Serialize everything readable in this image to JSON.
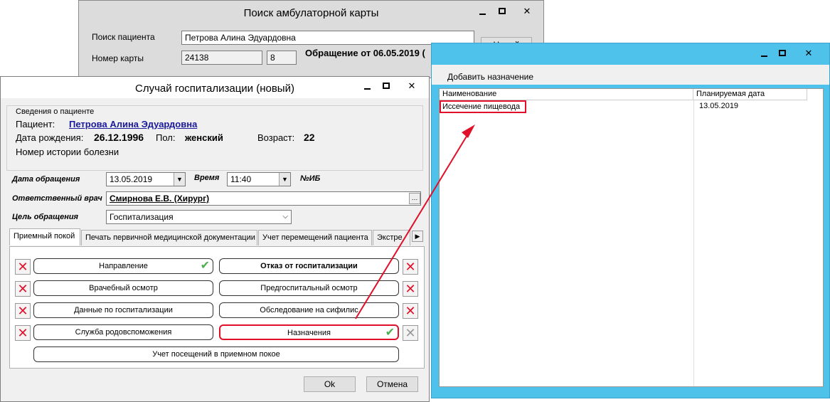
{
  "search_window": {
    "title": "Поиск амбулаторной карты",
    "patient_search_label": "Поиск пациента",
    "patient_search_value": "Петрова Алина Эдуардовна",
    "card_number_label": "Номер карты",
    "card_number_value": "24138",
    "card_suffix_value": "8",
    "visit_text": "Обращение от 06.05.2019 (",
    "new_button": "Новый"
  },
  "hosp_window": {
    "title": "Случай госпитализации (новый)",
    "patient_group_title": "Сведения о пациенте",
    "patient_label": "Пациент:",
    "patient_name": "Петрова Алина Эдуардовна",
    "dob_label": "Дата рождения:",
    "dob_value": "26.12.1996",
    "sex_label": "Пол:",
    "sex_value": "женский",
    "age_label": "Возраст:",
    "age_value": "22",
    "history_label": "Номер истории болезни",
    "visit_date_label": "Дата обращения",
    "visit_date_value": "13.05.2019",
    "time_label": "Время",
    "time_value": "11:40",
    "ib_label": "№ИБ",
    "doctor_label": "Ответственный врач",
    "doctor_value": "Смирнова Е.В. (Хирург)",
    "purpose_label": "Цель обращения",
    "purpose_value": "Госпитализация",
    "tabs": [
      "Приемный покой",
      "Печать первичной медицинской документации",
      "Учет перемещений пациента",
      "Экстре"
    ],
    "buttons": {
      "referral": "Направление",
      "refusal": "Отказ от госпитализации",
      "exam": "Врачебный осмотр",
      "preexam": "Предгоспитальный осмотр",
      "hospdata": "Данные по госпитализации",
      "syphilis": "Обследование на сифилис",
      "obstetric": "Служба родовспоможения",
      "prescriptions": "Назначения",
      "visits": "Учет посещений в приемном покое"
    },
    "ok": "Ok",
    "cancel": "Отмена"
  },
  "presc_window": {
    "add_button": "Добавить назначение",
    "columns": [
      "Наименование",
      "Планируемая дата"
    ],
    "rows": [
      {
        "name": "Иссечение пищевода",
        "date": "13.05.2019"
      }
    ]
  },
  "colors": {
    "accent_blue": "#4ec2eb",
    "highlight_red": "#e0102a",
    "link_blue": "#1a1a9c",
    "check_green": "#4caf50"
  }
}
